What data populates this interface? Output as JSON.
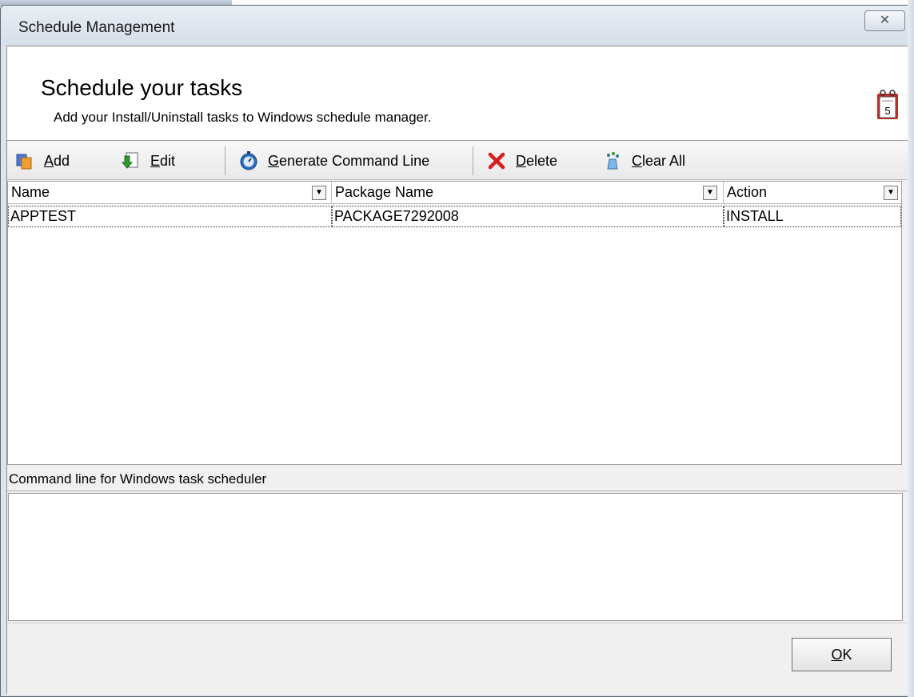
{
  "window": {
    "title": "Schedule Management",
    "close_glyph": "✕"
  },
  "header": {
    "title": "Schedule your tasks",
    "subtitle": "Add your Install/Uninstall tasks to Windows schedule manager.",
    "icon": "calendar-icon",
    "calendar_day": "5"
  },
  "toolbar": {
    "add": {
      "accel": "A",
      "rest": "dd",
      "icon": "add-icon"
    },
    "edit": {
      "accel": "E",
      "rest": "dit",
      "icon": "edit-icon"
    },
    "generate": {
      "accel": "G",
      "rest": "enerate Command Line",
      "icon": "stopwatch-icon"
    },
    "delete": {
      "accel": "D",
      "rest": "elete",
      "icon": "delete-icon"
    },
    "clear": {
      "accel": "C",
      "rest": "lear All",
      "icon": "clear-icon"
    }
  },
  "grid": {
    "columns": [
      {
        "label": "Name"
      },
      {
        "label": "Package Name"
      },
      {
        "label": "Action"
      }
    ],
    "dropdown_glyph": "▼",
    "rows": [
      {
        "name": "APPTEST",
        "package": "PACKAGE7292008",
        "action": "INSTALL"
      }
    ]
  },
  "command_line": {
    "label": "Command line for Windows task scheduler",
    "value": ""
  },
  "footer": {
    "ok": {
      "accel": "O",
      "rest": "K"
    }
  },
  "colors": {
    "delete_red": "#d81c1c",
    "accent_blue": "#2a6fc0"
  }
}
